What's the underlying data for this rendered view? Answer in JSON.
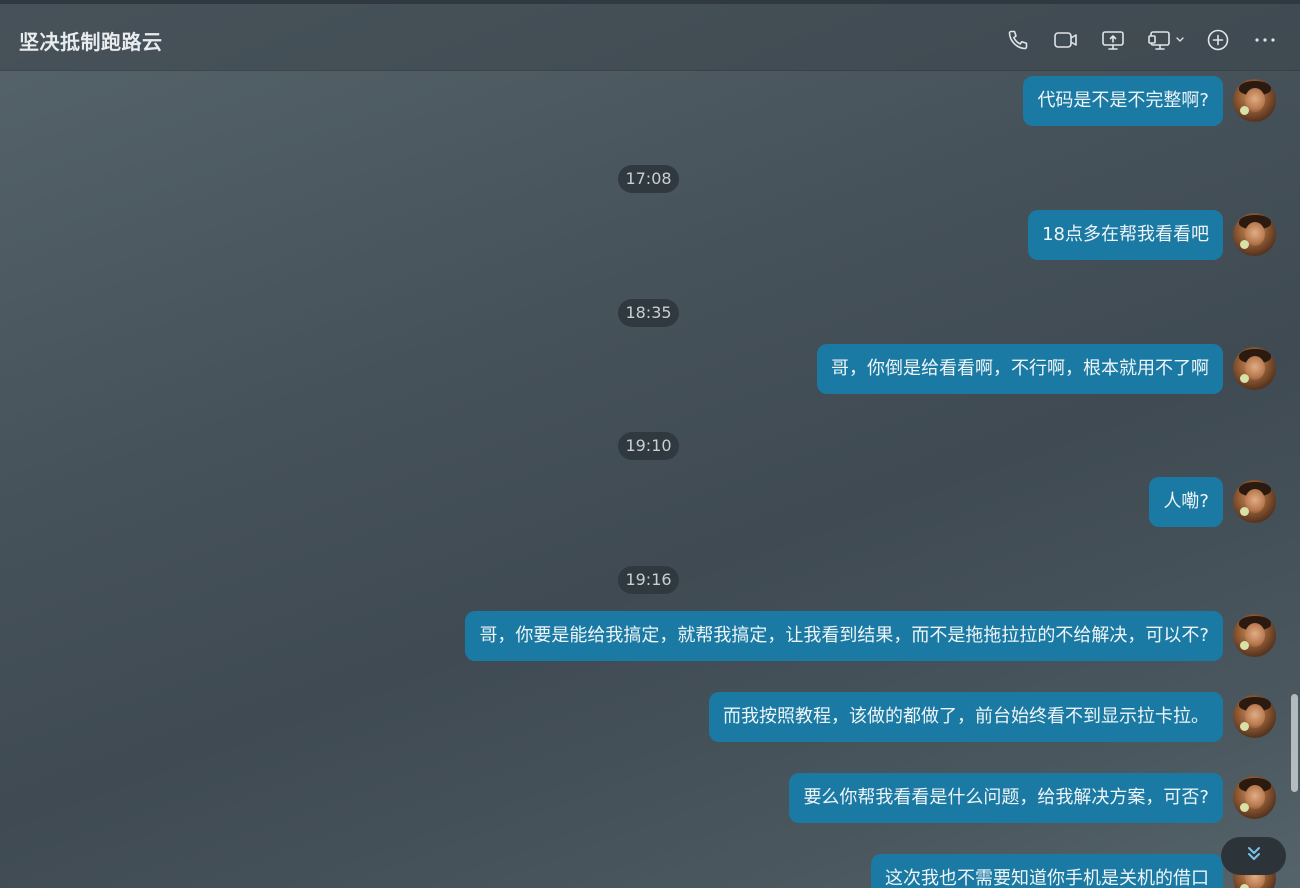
{
  "header": {
    "title": "坚决抵制跑路云",
    "icons": [
      "phone-icon",
      "video-icon",
      "screen-share-icon",
      "remote-desktop-icon",
      "add-icon",
      "more-icon"
    ]
  },
  "messages": [
    {
      "type": "text",
      "text": "代码是不是不完整啊?"
    },
    {
      "type": "time",
      "text": "17:08"
    },
    {
      "type": "text",
      "text": "18点多在帮我看看吧"
    },
    {
      "type": "time",
      "text": "18:35"
    },
    {
      "type": "text",
      "text": "哥，你倒是给看看啊，不行啊，根本就用不了啊"
    },
    {
      "type": "time",
      "text": "19:10"
    },
    {
      "type": "text",
      "text": "人嘞?"
    },
    {
      "type": "time",
      "text": "19:16"
    },
    {
      "type": "text",
      "text": "哥，你要是能给我搞定，就帮我搞定，让我看到结果，而不是拖拖拉拉的不给解决，可以不?"
    },
    {
      "type": "text",
      "text": "而我按照教程，该做的都做了，前台始终看不到显示拉卡拉。"
    },
    {
      "type": "text",
      "text": "要么你帮我看看是什么问题，给我解决方案，可否?"
    },
    {
      "type": "text",
      "text": "这次我也不需要知道你手机是关机的借口"
    }
  ],
  "colors": {
    "bubble": "#1b7aa3",
    "time_pill": "#2f393f",
    "background": "#46525a"
  }
}
